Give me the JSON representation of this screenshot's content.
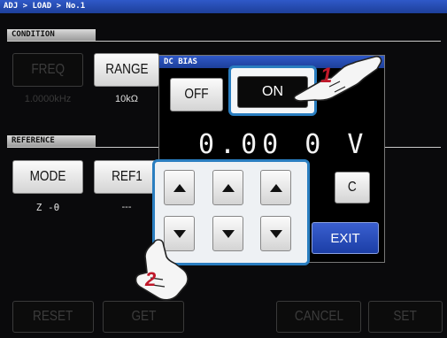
{
  "breadcrumb": "ADJ > LOAD > No.1",
  "sections": {
    "condition": "CONDITION",
    "reference": "REFERENCE"
  },
  "condition": {
    "freq": {
      "label": "FREQ",
      "value": "1.0000kHz"
    },
    "range": {
      "label": "RANGE",
      "value": "10kΩ"
    }
  },
  "reference": {
    "mode": {
      "label": "MODE",
      "value": "Z -θ"
    },
    "ref1": {
      "label": "REF1",
      "value": "---"
    }
  },
  "dialog": {
    "title": "DC BIAS",
    "off_label": "OFF",
    "on_label": "ON",
    "voltage": "0.00 0 V",
    "clear_label": "C",
    "exit_label": "EXIT"
  },
  "bottom": {
    "reset": "RESET",
    "get": "GET",
    "cancel": "CANCEL",
    "set": "SET"
  },
  "callouts": {
    "step1": "1",
    "step2": "2"
  },
  "colors": {
    "title_bar": "#2445b0",
    "highlight": "#2a7ec0",
    "exit": "#2a4fc0",
    "callout": "#c0182a"
  }
}
